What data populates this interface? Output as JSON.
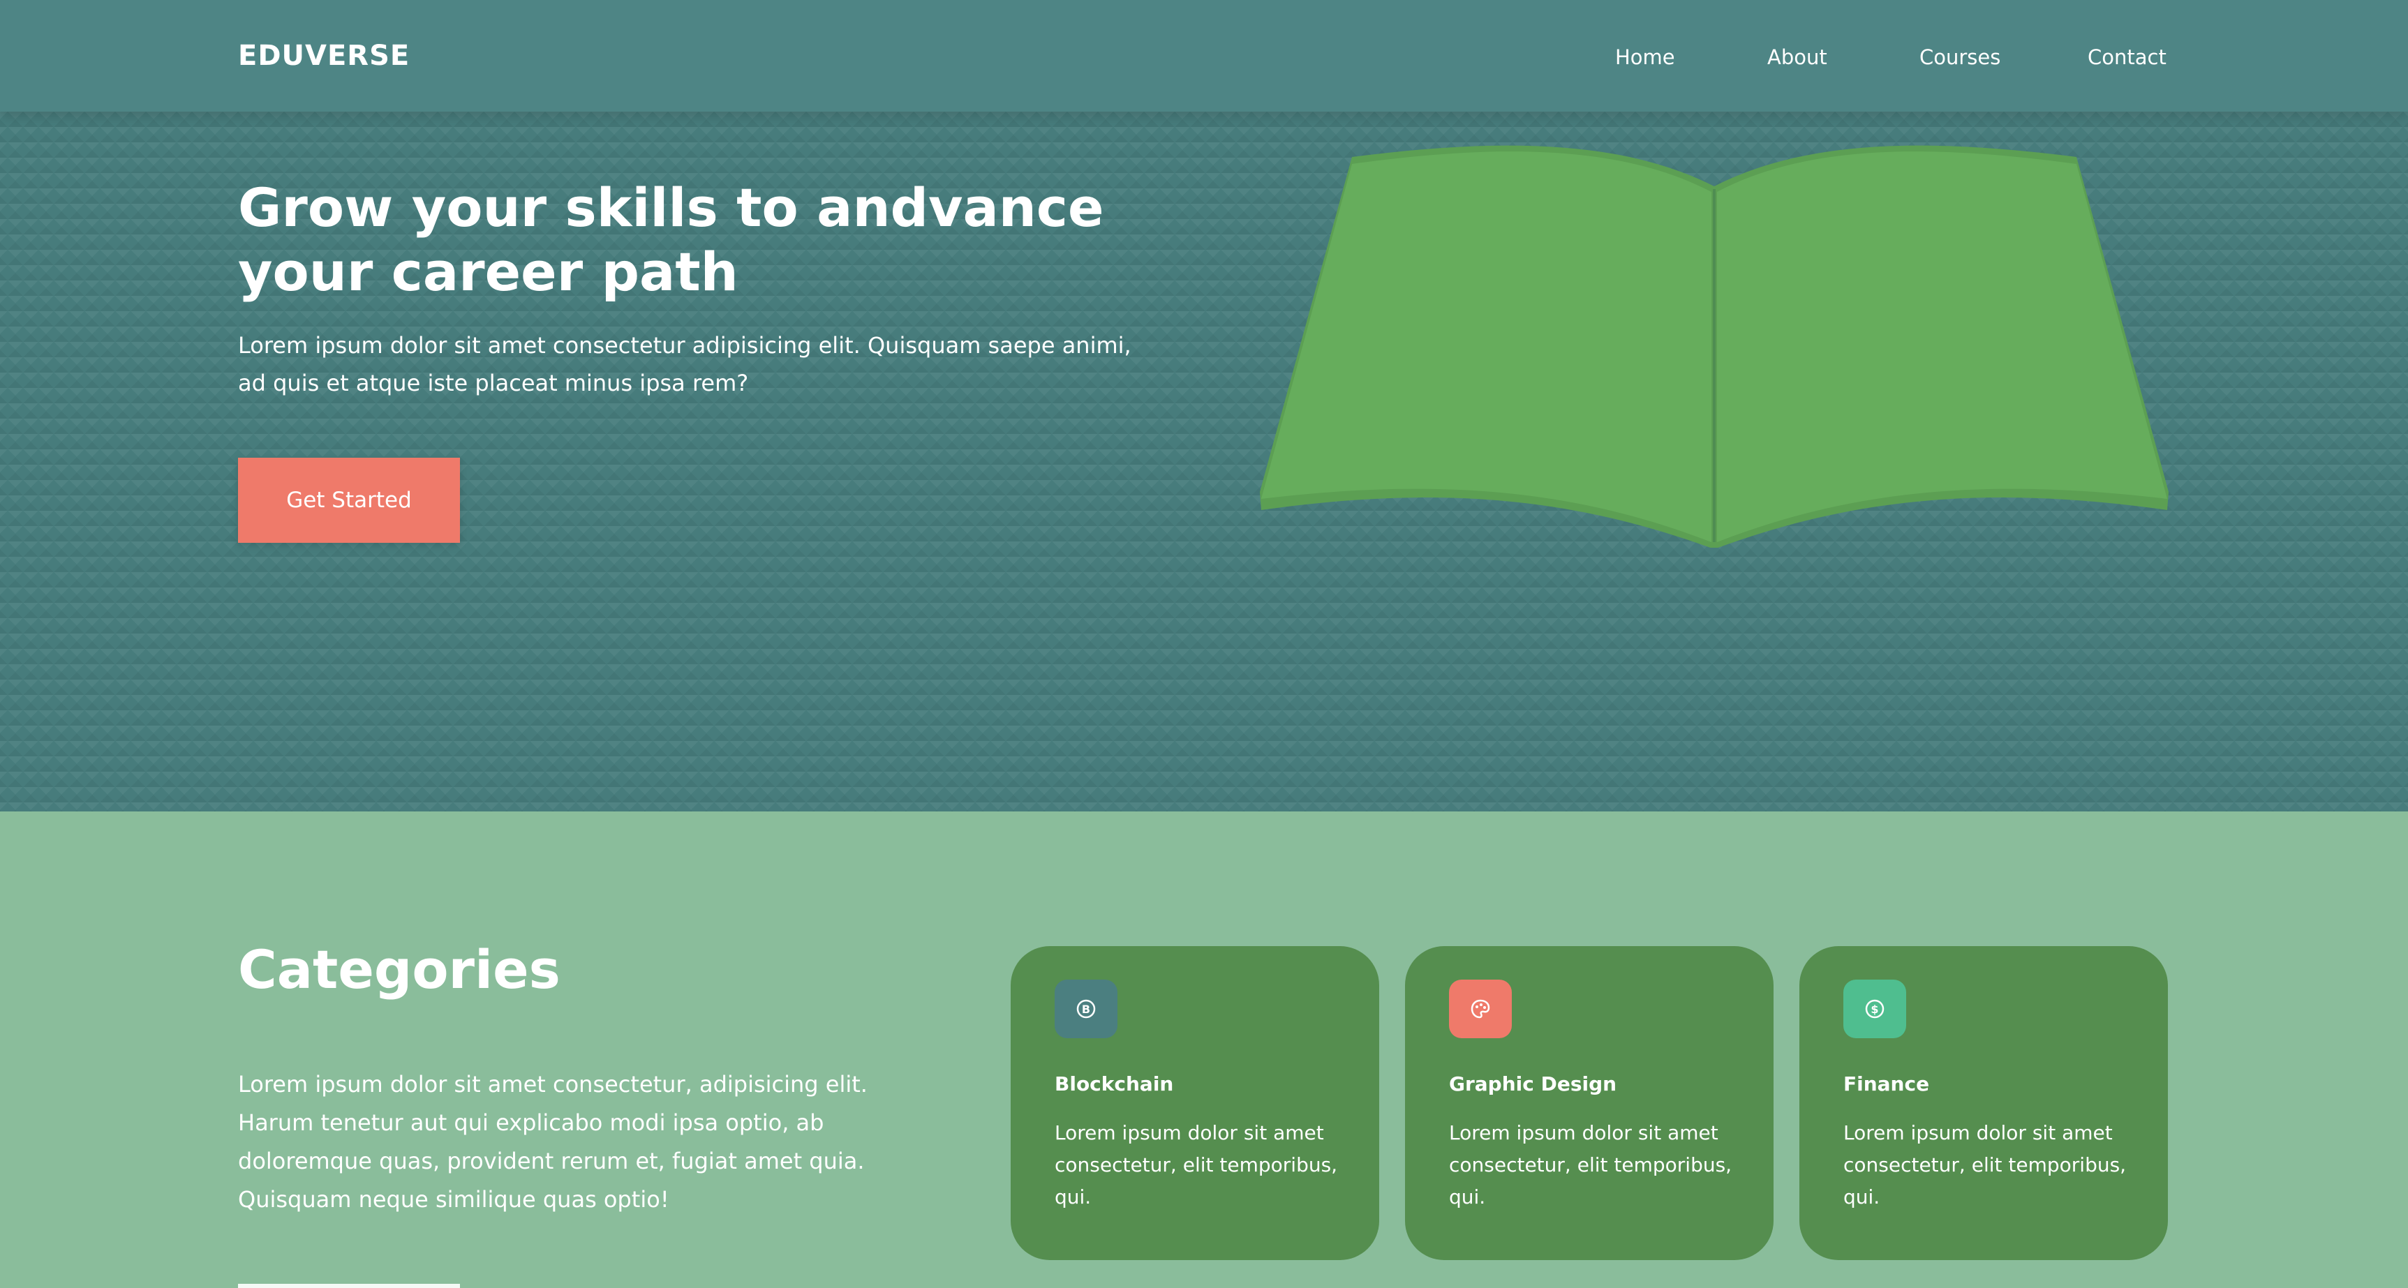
{
  "brand": {
    "name": "EDUVERSE"
  },
  "nav": {
    "links": [
      "Home",
      "About",
      "Courses",
      "Contact"
    ]
  },
  "hero": {
    "title": "Grow your skills to andvance your career path",
    "text": "Lorem ipsum dolor sit amet consectetur adipisicing elit. Quisquam saepe animi, ad quis et atque iste placeat minus ipsa rem?",
    "cta_label": "Get Started",
    "illustration": "open-book-icon"
  },
  "categories": {
    "title": "Categories",
    "text": "Lorem ipsum dolor sit amet consectetur, adipisicing elit. Harum tenetur aut qui explicabo modi ipsa optio, ab doloremque quas, provident rerum et, fugiat amet quia. Quisquam neque similique quas optio!",
    "cards": [
      {
        "title": "Blockchain",
        "text": "Lorem ipsum dolor sit amet consectetur, elit temporibus, qui.",
        "icon": "bitcoin-icon",
        "icon_color": "#4b7f80"
      },
      {
        "title": "Graphic Design",
        "text": "Lorem ipsum dolor sit amet consectetur, elit temporibus, qui.",
        "icon": "palette-icon",
        "icon_color": "#ef7a6a"
      },
      {
        "title": "Finance",
        "text": "Lorem ipsum dolor sit amet consectetur, elit temporibus, qui.",
        "icon": "dollar-icon",
        "icon_color": "#4fbe8f"
      }
    ]
  },
  "colors": {
    "navbar": "#4e8585",
    "hero_bg": "#477c7c",
    "accent": "#ef7a6a",
    "book": "#66ad5c",
    "section_bg": "#8abd9b",
    "card_bg": "#558e4f"
  }
}
